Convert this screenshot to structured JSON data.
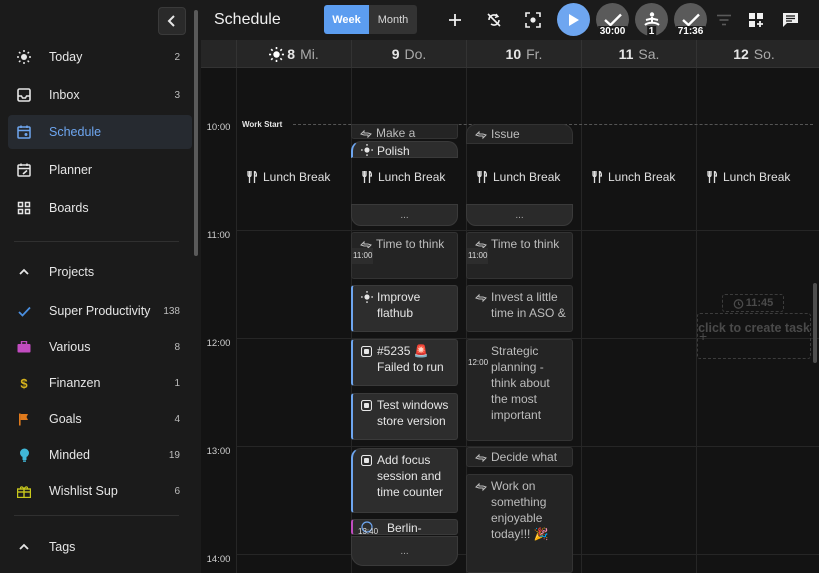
{
  "sidebar": {
    "nav": [
      {
        "label": "Today",
        "count": "2",
        "icon": "sun-icon"
      },
      {
        "label": "Inbox",
        "count": "3",
        "icon": "inbox-icon"
      },
      {
        "label": "Schedule",
        "count": "",
        "icon": "calendar-icon"
      },
      {
        "label": "Planner",
        "count": "",
        "icon": "calendar-edit-icon"
      },
      {
        "label": "Boards",
        "count": "",
        "icon": "grid-icon"
      }
    ],
    "projects_label": "Projects",
    "projects": [
      {
        "label": "Super Productivity",
        "count": "138",
        "icon": "check-icon",
        "color": "#4a8fe0"
      },
      {
        "label": "Various",
        "count": "8",
        "icon": "briefcase-icon",
        "color": "#c24cc0"
      },
      {
        "label": "Finanzen",
        "count": "1",
        "icon": "dollar-icon",
        "color": "#d8b41c"
      },
      {
        "label": "Goals",
        "count": "4",
        "icon": "flag-icon",
        "color": "#e07a1c"
      },
      {
        "label": "Minded",
        "count": "19",
        "icon": "lightbulb-icon",
        "color": "#40b8d8"
      },
      {
        "label": "Wishlist Sup",
        "count": "6",
        "icon": "gift-icon",
        "color": "#c8c81c"
      }
    ],
    "tags_label": "Tags"
  },
  "header": {
    "title": "Schedule",
    "week_label": "Week",
    "month_label": "Month",
    "timer1": "30:00",
    "timer2": "1",
    "timer3": "71:36",
    "accent_color": "#6ea6f0"
  },
  "calendar": {
    "days": [
      {
        "num": "8",
        "name": "Mi."
      },
      {
        "num": "9",
        "name": "Do."
      },
      {
        "num": "10",
        "name": "Fr."
      },
      {
        "num": "11",
        "name": "Sa."
      },
      {
        "num": "12",
        "name": "So."
      }
    ],
    "times": [
      "10:00",
      "11:00",
      "12:00",
      "13:00",
      "14:00"
    ],
    "work_start": "Work Start",
    "lunch_label": "Lunch Break",
    "more_label": "...",
    "ghost_time": "11:45",
    "ghost_add": "click to create task",
    "tasks": {
      "make_a": "Make a",
      "polish": "Polish",
      "issue": "Issue",
      "time_to_think": "Time to think",
      "time_badge_1100": "11:00",
      "improve_flathub": "Improve flathub",
      "invest_aso": "Invest a little time in ASO &",
      "failed_run": "#5235 🚨 Failed to run",
      "strategic": "Strategic planning - think about the most important",
      "time_badge_1200": "12:00",
      "test_windows": "Test windows store version",
      "decide_what": "Decide what",
      "add_focus": "Add focus session and time counter",
      "work_on": "Work on something enjoyable today!!! 🎉",
      "berlin": "Berlin-",
      "time_badge_1340": "13:40"
    }
  }
}
